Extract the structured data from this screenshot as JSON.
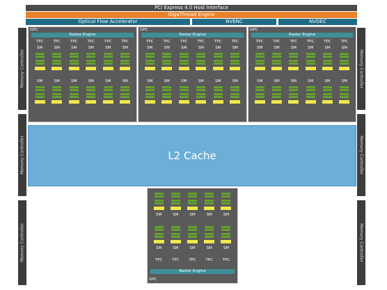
{
  "top": {
    "pcie_label": "PCI Express 4.0 Host Interface",
    "gigathread_label": "GigaThread Engine",
    "engines": [
      "Optical Flow Accelerator",
      "NVENC",
      "NVDEC"
    ]
  },
  "memory_controller_label": "Memory Controller",
  "gpc": {
    "label": "GPC",
    "raster_label": "Raster Engine",
    "tpc_label": "TPC",
    "sm_label": "SM",
    "count": 4,
    "tpcs_per_gpc": 6,
    "bottom_gpc_tpcs": 5
  },
  "l2_cache_label": "L2 Cache",
  "colors": {
    "pcie": "#4a4a4a",
    "gigathread": "#e8822a",
    "engine": "#1f6b86",
    "gpc_fill": "#5a5a5a",
    "raster": "#3f8f99",
    "sm_core": "#66a12e",
    "sm_cache": "#f0e84c",
    "l2": "#6baed8",
    "memory_controller": "#3c3c3c"
  }
}
